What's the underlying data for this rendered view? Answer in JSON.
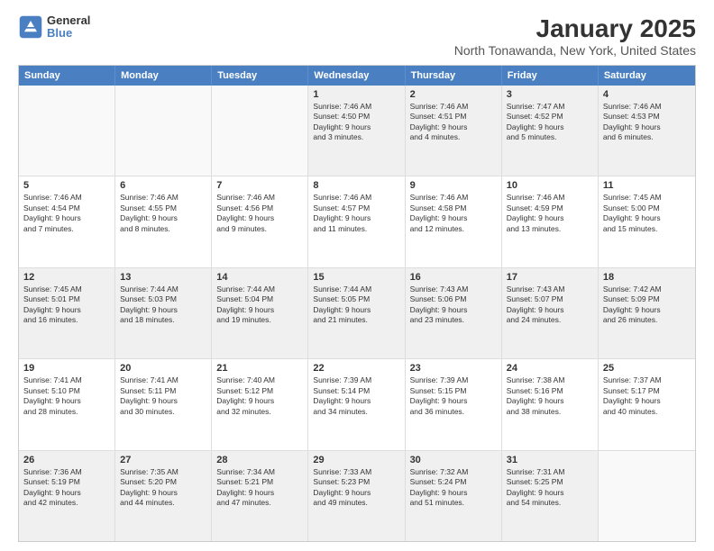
{
  "logo": {
    "line1": "General",
    "line2": "Blue"
  },
  "title": "January 2025",
  "subtitle": "North Tonawanda, New York, United States",
  "days": [
    "Sunday",
    "Monday",
    "Tuesday",
    "Wednesday",
    "Thursday",
    "Friday",
    "Saturday"
  ],
  "weeks": [
    [
      {
        "num": "",
        "text": "",
        "empty": true
      },
      {
        "num": "",
        "text": "",
        "empty": true
      },
      {
        "num": "",
        "text": "",
        "empty": true
      },
      {
        "num": "1",
        "text": "Sunrise: 7:46 AM\nSunset: 4:50 PM\nDaylight: 9 hours\nand 3 minutes."
      },
      {
        "num": "2",
        "text": "Sunrise: 7:46 AM\nSunset: 4:51 PM\nDaylight: 9 hours\nand 4 minutes."
      },
      {
        "num": "3",
        "text": "Sunrise: 7:47 AM\nSunset: 4:52 PM\nDaylight: 9 hours\nand 5 minutes."
      },
      {
        "num": "4",
        "text": "Sunrise: 7:46 AM\nSunset: 4:53 PM\nDaylight: 9 hours\nand 6 minutes."
      }
    ],
    [
      {
        "num": "5",
        "text": "Sunrise: 7:46 AM\nSunset: 4:54 PM\nDaylight: 9 hours\nand 7 minutes."
      },
      {
        "num": "6",
        "text": "Sunrise: 7:46 AM\nSunset: 4:55 PM\nDaylight: 9 hours\nand 8 minutes."
      },
      {
        "num": "7",
        "text": "Sunrise: 7:46 AM\nSunset: 4:56 PM\nDaylight: 9 hours\nand 9 minutes."
      },
      {
        "num": "8",
        "text": "Sunrise: 7:46 AM\nSunset: 4:57 PM\nDaylight: 9 hours\nand 11 minutes."
      },
      {
        "num": "9",
        "text": "Sunrise: 7:46 AM\nSunset: 4:58 PM\nDaylight: 9 hours\nand 12 minutes."
      },
      {
        "num": "10",
        "text": "Sunrise: 7:46 AM\nSunset: 4:59 PM\nDaylight: 9 hours\nand 13 minutes."
      },
      {
        "num": "11",
        "text": "Sunrise: 7:45 AM\nSunset: 5:00 PM\nDaylight: 9 hours\nand 15 minutes."
      }
    ],
    [
      {
        "num": "12",
        "text": "Sunrise: 7:45 AM\nSunset: 5:01 PM\nDaylight: 9 hours\nand 16 minutes."
      },
      {
        "num": "13",
        "text": "Sunrise: 7:44 AM\nSunset: 5:03 PM\nDaylight: 9 hours\nand 18 minutes."
      },
      {
        "num": "14",
        "text": "Sunrise: 7:44 AM\nSunset: 5:04 PM\nDaylight: 9 hours\nand 19 minutes."
      },
      {
        "num": "15",
        "text": "Sunrise: 7:44 AM\nSunset: 5:05 PM\nDaylight: 9 hours\nand 21 minutes."
      },
      {
        "num": "16",
        "text": "Sunrise: 7:43 AM\nSunset: 5:06 PM\nDaylight: 9 hours\nand 23 minutes."
      },
      {
        "num": "17",
        "text": "Sunrise: 7:43 AM\nSunset: 5:07 PM\nDaylight: 9 hours\nand 24 minutes."
      },
      {
        "num": "18",
        "text": "Sunrise: 7:42 AM\nSunset: 5:09 PM\nDaylight: 9 hours\nand 26 minutes."
      }
    ],
    [
      {
        "num": "19",
        "text": "Sunrise: 7:41 AM\nSunset: 5:10 PM\nDaylight: 9 hours\nand 28 minutes."
      },
      {
        "num": "20",
        "text": "Sunrise: 7:41 AM\nSunset: 5:11 PM\nDaylight: 9 hours\nand 30 minutes."
      },
      {
        "num": "21",
        "text": "Sunrise: 7:40 AM\nSunset: 5:12 PM\nDaylight: 9 hours\nand 32 minutes."
      },
      {
        "num": "22",
        "text": "Sunrise: 7:39 AM\nSunset: 5:14 PM\nDaylight: 9 hours\nand 34 minutes."
      },
      {
        "num": "23",
        "text": "Sunrise: 7:39 AM\nSunset: 5:15 PM\nDaylight: 9 hours\nand 36 minutes."
      },
      {
        "num": "24",
        "text": "Sunrise: 7:38 AM\nSunset: 5:16 PM\nDaylight: 9 hours\nand 38 minutes."
      },
      {
        "num": "25",
        "text": "Sunrise: 7:37 AM\nSunset: 5:17 PM\nDaylight: 9 hours\nand 40 minutes."
      }
    ],
    [
      {
        "num": "26",
        "text": "Sunrise: 7:36 AM\nSunset: 5:19 PM\nDaylight: 9 hours\nand 42 minutes."
      },
      {
        "num": "27",
        "text": "Sunrise: 7:35 AM\nSunset: 5:20 PM\nDaylight: 9 hours\nand 44 minutes."
      },
      {
        "num": "28",
        "text": "Sunrise: 7:34 AM\nSunset: 5:21 PM\nDaylight: 9 hours\nand 47 minutes."
      },
      {
        "num": "29",
        "text": "Sunrise: 7:33 AM\nSunset: 5:23 PM\nDaylight: 9 hours\nand 49 minutes."
      },
      {
        "num": "30",
        "text": "Sunrise: 7:32 AM\nSunset: 5:24 PM\nDaylight: 9 hours\nand 51 minutes."
      },
      {
        "num": "31",
        "text": "Sunrise: 7:31 AM\nSunset: 5:25 PM\nDaylight: 9 hours\nand 54 minutes."
      },
      {
        "num": "",
        "text": "",
        "empty": true
      }
    ]
  ]
}
